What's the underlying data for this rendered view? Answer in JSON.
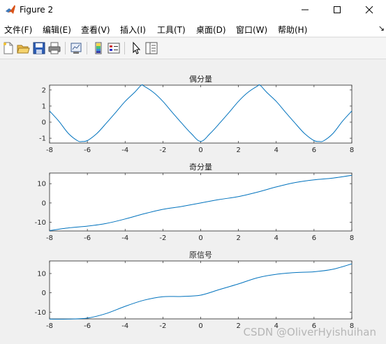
{
  "window": {
    "title": "Figure 2",
    "controls": [
      "minimize",
      "maximize",
      "close"
    ]
  },
  "menubar": {
    "items": [
      "文件(F)",
      "编辑(E)",
      "查看(V)",
      "插入(I)",
      "工具(T)",
      "桌面(D)",
      "窗口(W)",
      "帮助(H)"
    ],
    "overflow_glyph": "↘"
  },
  "toolbar": {
    "buttons": [
      "new-figure-icon",
      "open-file-icon",
      "save-icon",
      "print-icon",
      "link-plot-icon",
      "colorbar-icon",
      "legend-icon",
      "pointer-icon",
      "property-inspector-icon"
    ]
  },
  "chart_data": [
    {
      "type": "line",
      "title": "偶分量",
      "xlim": [
        -8,
        8
      ],
      "ylim": [
        -1.3,
        2.3
      ],
      "xticks": [
        "-8",
        "-6",
        "-4",
        "-2",
        "0",
        "2",
        "4",
        "6",
        "8"
      ],
      "yticks": [
        "2",
        "1",
        "0",
        "-1"
      ],
      "line_color": "#0072bd",
      "x": [
        -8,
        -7.5,
        -7,
        -6.5,
        -6.28,
        -6,
        -5.5,
        -5,
        -4.5,
        -4,
        -3.5,
        -3.14,
        -3,
        -2.5,
        -2,
        -1.5,
        -1,
        -0.5,
        0,
        0.5,
        1,
        1.5,
        2,
        2.5,
        3,
        3.14,
        3.5,
        4,
        4.5,
        5,
        5.5,
        6,
        6.28,
        6.5,
        7,
        7.5,
        8
      ],
      "y": [
        0.69,
        0.05,
        -0.71,
        -1.17,
        -1.2,
        -1.15,
        -0.71,
        -0.07,
        0.6,
        1.29,
        1.85,
        2.3,
        2.24,
        1.85,
        1.29,
        0.6,
        -0.07,
        -0.71,
        -1.2,
        -0.71,
        -0.07,
        0.6,
        1.29,
        1.85,
        2.24,
        2.3,
        1.85,
        1.29,
        0.6,
        -0.07,
        -0.71,
        -1.15,
        -1.2,
        -1.17,
        -0.71,
        0.05,
        0.69
      ]
    },
    {
      "type": "line",
      "title": "奇分量",
      "xlim": [
        -8,
        8
      ],
      "ylim": [
        -14.5,
        15.5
      ],
      "xticks": [
        "-8",
        "-6",
        "-4",
        "-2",
        "0",
        "2",
        "4",
        "6",
        "8"
      ],
      "yticks": [
        "10",
        "0",
        "-10"
      ],
      "line_color": "#0072bd",
      "x": [
        -8,
        -7,
        -6,
        -5,
        -4,
        -3,
        -2,
        -1,
        0,
        1,
        2,
        3,
        4,
        5,
        6,
        7,
        8
      ],
      "y": [
        -14.3,
        -12.9,
        -12.0,
        -10.6,
        -8.3,
        -5.6,
        -3.3,
        -1.8,
        0,
        1.8,
        3.3,
        5.6,
        8.3,
        10.6,
        12.0,
        12.9,
        14.3
      ]
    },
    {
      "type": "line",
      "title": "原信号",
      "xlim": [
        -8,
        8
      ],
      "ylim": [
        -13.5,
        16.5
      ],
      "xticks": [
        "-8",
        "-6",
        "-4",
        "-2",
        "0",
        "2",
        "4",
        "6",
        "8"
      ],
      "yticks": [
        "10",
        "0",
        "-10"
      ],
      "line_color": "#0072bd",
      "x": [
        -8,
        -7,
        -6,
        -5,
        -4,
        -3,
        -2,
        -1,
        0,
        1,
        2,
        3,
        4,
        5,
        6,
        7,
        8
      ],
      "y": [
        -13.6,
        -13.6,
        -13.1,
        -10.7,
        -7.0,
        -3.8,
        -2.0,
        -1.9,
        -1.2,
        1.7,
        4.6,
        7.8,
        9.6,
        10.5,
        10.9,
        12.2,
        15.0
      ]
    }
  ],
  "watermark": "CSDN @OliverHyishuihan"
}
